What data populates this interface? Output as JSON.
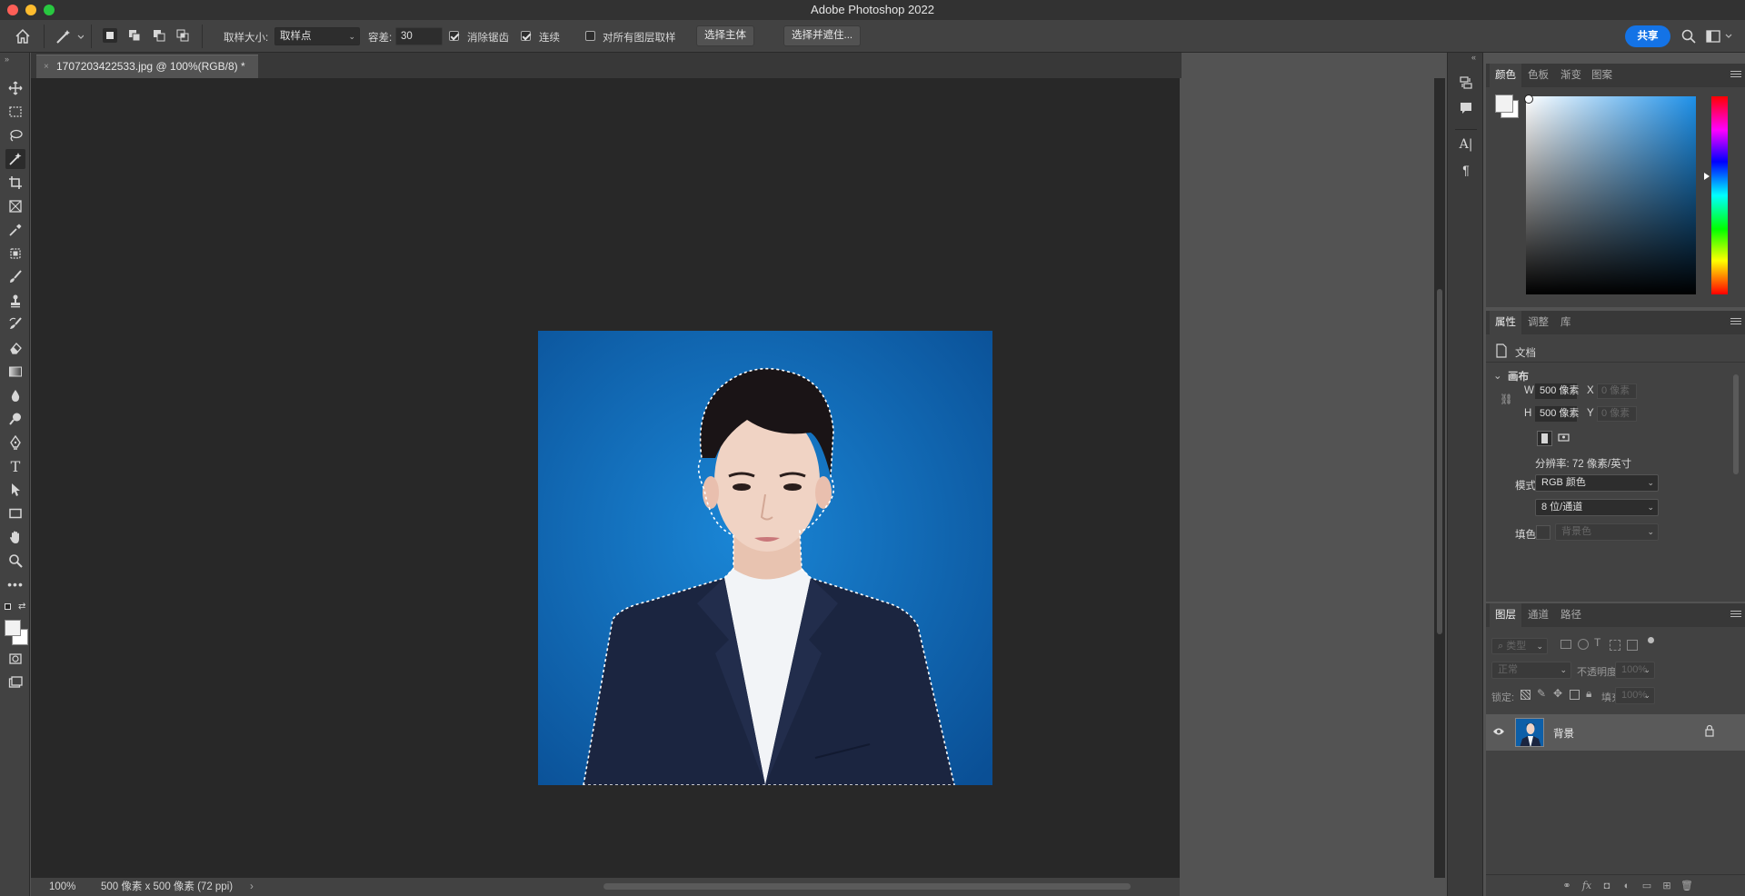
{
  "app": {
    "title": "Adobe Photoshop 2022"
  },
  "options_bar": {
    "sample_size_label": "取样大小:",
    "sample_size_value": "取样点",
    "tolerance_label": "容差:",
    "tolerance_value": "30",
    "anti_alias_label": "消除锯齿",
    "anti_alias_checked": true,
    "contiguous_label": "连续",
    "contiguous_checked": true,
    "sample_all_layers_label": "对所有图层取样",
    "sample_all_layers_checked": false,
    "select_subject_label": "选择主体",
    "select_and_mask_label": "选择并遮住...",
    "share_label": "共享"
  },
  "document": {
    "tab_title": "1707203422533.jpg @ 100%(RGB/8) *",
    "zoom": "100%",
    "status": "500 像素 x 500 像素 (72 ppi)"
  },
  "toolbar": {
    "tools": [
      "move",
      "marquee",
      "lasso",
      "magic-wand",
      "crop",
      "frame",
      "eyedropper",
      "healing",
      "brush",
      "clone-stamp",
      "history-brush",
      "eraser",
      "gradient",
      "blur",
      "dodge",
      "pen",
      "type",
      "path-select",
      "rectangle",
      "hand",
      "zoom",
      "more"
    ],
    "active_tool": "magic-wand",
    "foreground_color": "#f2f2f2",
    "background_color": "#ffffff"
  },
  "color_panel": {
    "tabs": [
      "颜色",
      "色板",
      "渐变",
      "图案"
    ],
    "active_tab": "颜色",
    "hue_color": "#1e90e8"
  },
  "properties_panel": {
    "tabs": [
      "属性",
      "调整",
      "库"
    ],
    "active_tab": "属性",
    "doc_label": "文档",
    "section_label": "画布",
    "w_label": "W",
    "w_value": "500 像素",
    "h_label": "H",
    "h_value": "500 像素",
    "x_label": "X",
    "x_placeholder": "0 像素",
    "y_label": "Y",
    "y_placeholder": "0 像素",
    "resolution": "分辨率: 72 像素/英寸",
    "mode_label": "模式",
    "mode_value": "RGB 颜色",
    "depth_value": "8 位/通道",
    "fill_label": "填色",
    "fill_value": "背景色"
  },
  "layers_panel": {
    "tabs": [
      "图层",
      "通道",
      "路径"
    ],
    "active_tab": "图层",
    "filter_placeholder": "类型",
    "blend_mode": "正常",
    "opacity_label": "不透明度:",
    "opacity_value": "100%",
    "lock_label": "锁定:",
    "fill_label": "填充:",
    "fill_value": "100%",
    "layers": [
      {
        "name": "背景",
        "visible": true,
        "locked": true
      }
    ]
  },
  "colors": {
    "accent": "#1473e6",
    "photo_bg": "#0d5fa8",
    "suit": "#1b2540"
  }
}
